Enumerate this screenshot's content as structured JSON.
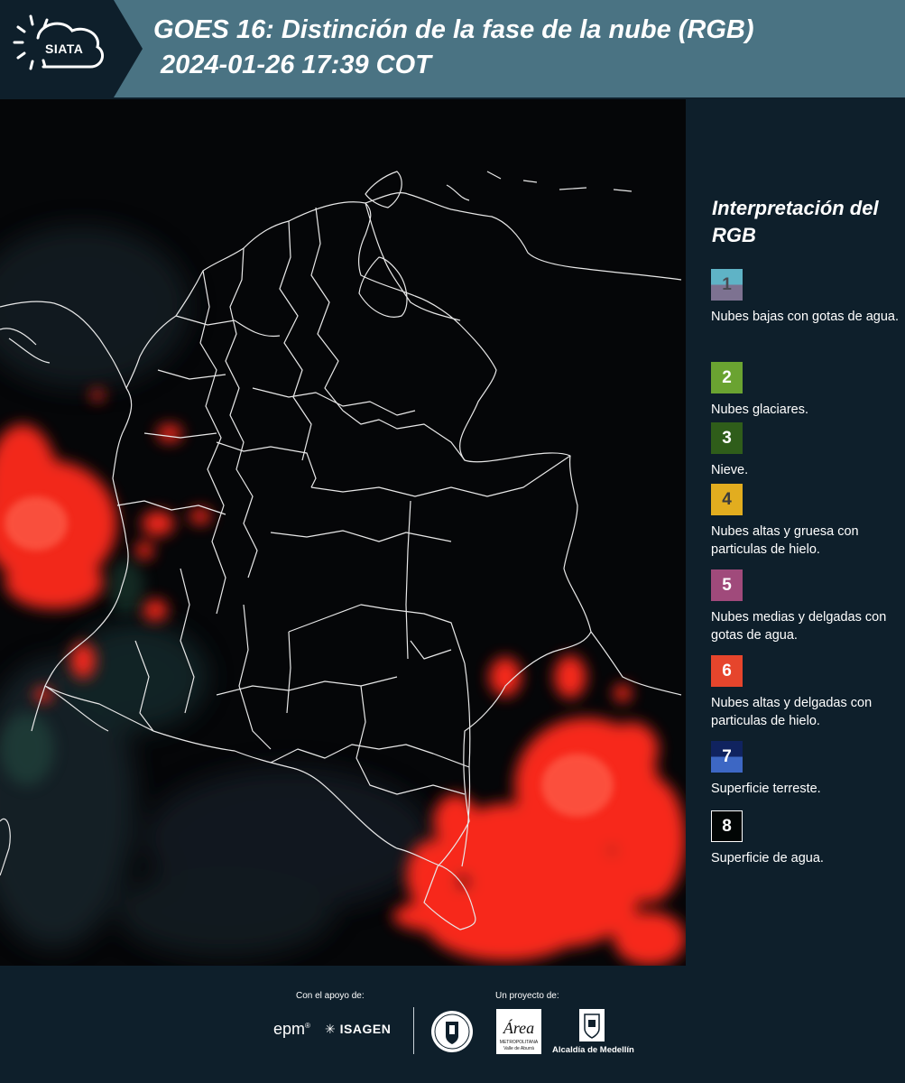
{
  "header": {
    "logo_text": "SIATA",
    "title": "GOES 16: Distinción de la fase de la nube (RGB)",
    "subtitle": "2024-01-26 17:39 COT"
  },
  "legend": {
    "title": "Interpretación del RGB",
    "items": [
      {
        "number": "1",
        "label": "Nubes bajas con gotas de agua.",
        "color_top": "#5fb3c6",
        "color_bottom": "#7d7291",
        "number_color": "#4a4a52"
      },
      {
        "number": "2",
        "label": "Nubes glaciares.",
        "color_top": "#6aa331",
        "color_bottom": "#6aa331",
        "number_color": "#ffffff"
      },
      {
        "number": "3",
        "label": "Nieve.",
        "color_top": "#2f5d1a",
        "color_bottom": "#2f5d1a",
        "number_color": "#ffffff"
      },
      {
        "number": "4",
        "label": "Nubes altas y gruesa con particulas de hielo.",
        "color_top": "#e2ad1f",
        "color_bottom": "#e2ad1f",
        "number_color": "#3b3b3b"
      },
      {
        "number": "5",
        "label": "Nubes medias y delgadas con gotas de agua.",
        "color_top": "#a04a7b",
        "color_bottom": "#a04a7b",
        "number_color": "#ffffff"
      },
      {
        "number": "6",
        "label": "Nubes altas y delgadas con particulas de hielo.",
        "color_top": "#e6452c",
        "color_bottom": "#e6452c",
        "number_color": "#ffffff"
      },
      {
        "number": "7",
        "label": "Superficie terreste.",
        "color_top": "#10235f",
        "color_bottom": "#3d67c4",
        "number_color": "#ffffff"
      },
      {
        "number": "8",
        "label": "Superficie de agua.",
        "color_top": "#020605",
        "color_bottom": "#020605",
        "number_color": "#ffffff"
      }
    ]
  },
  "footer": {
    "support_label": "Con el apoyo de:",
    "project_label": "Un proyecto de:",
    "epm": "epm",
    "isagen": "ISAGEN",
    "area_name": "Área",
    "area_sub": "METROPOLITANA",
    "area_sub2": "Valle de Aburrá",
    "alcaldia": "Alcaldía de Medellín"
  },
  "colors": {
    "header_bg": "#4a7383",
    "panel_bg": "#0e1f2b",
    "cloud_red": "#ff2a1e",
    "border_lines": "#e8e8e8"
  }
}
